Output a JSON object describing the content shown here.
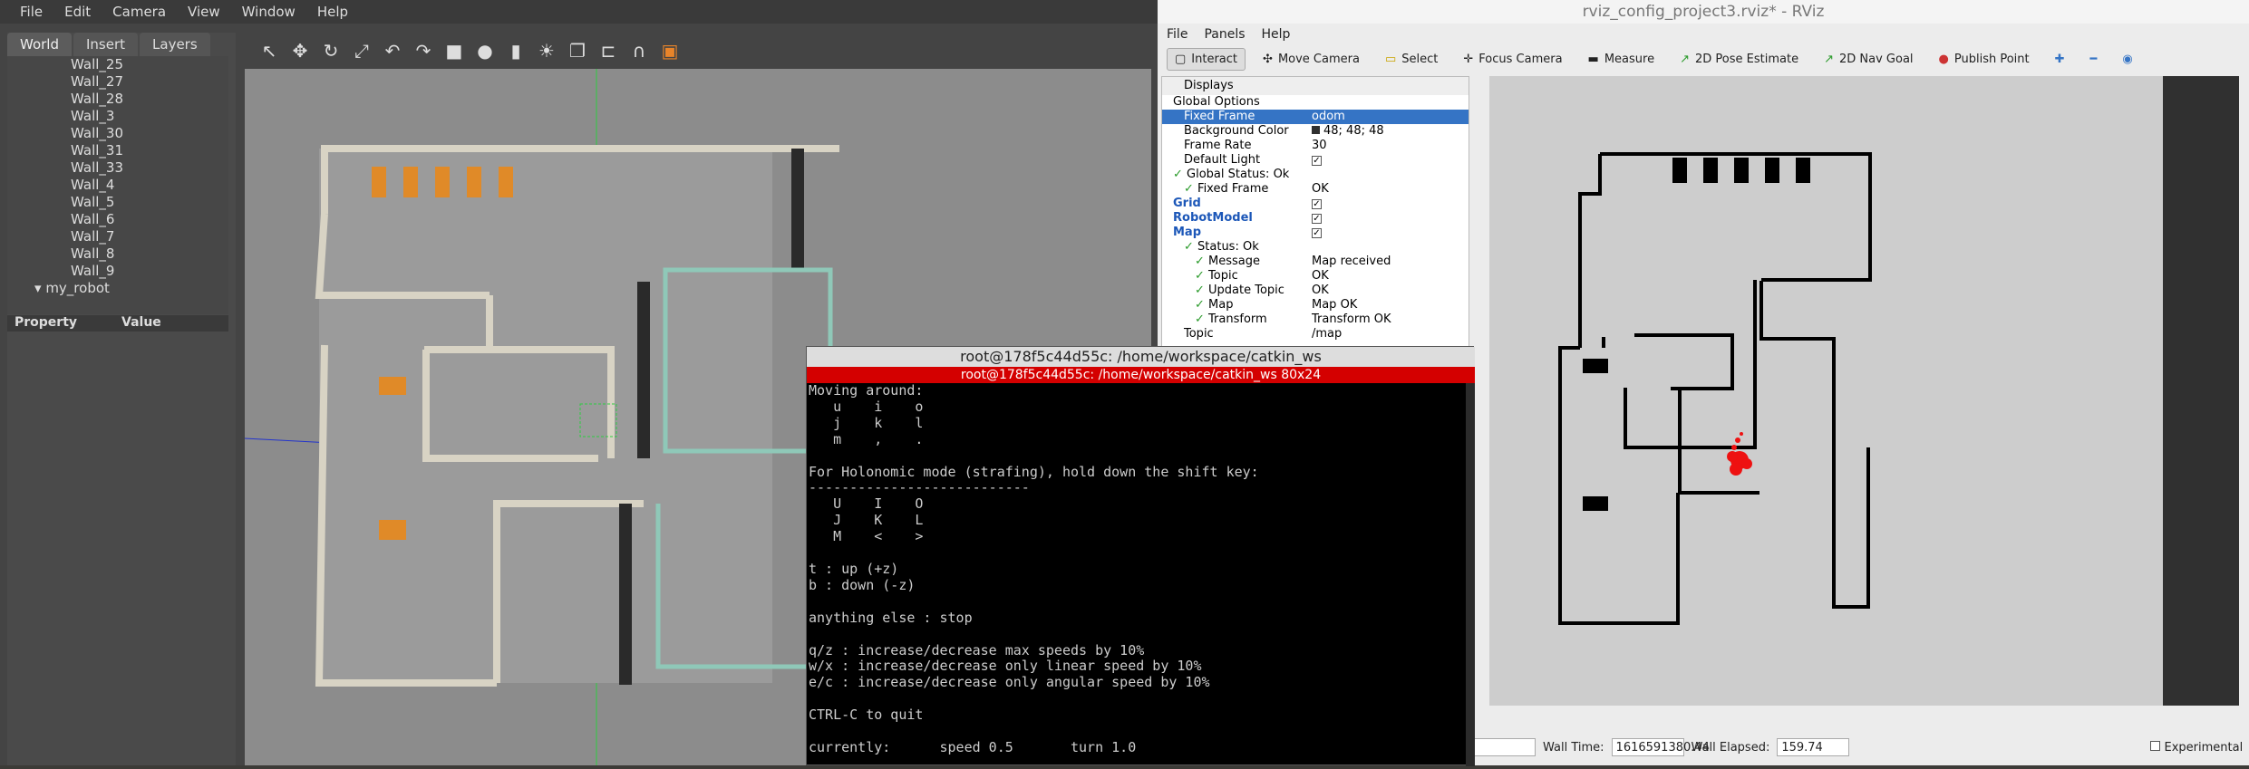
{
  "gazebo": {
    "menu": [
      "File",
      "Edit",
      "Camera",
      "View",
      "Window",
      "Help"
    ],
    "tabs": [
      "World",
      "Insert",
      "Layers"
    ],
    "tree": [
      "Wall_25",
      "Wall_27",
      "Wall_28",
      "Wall_3",
      "Wall_30",
      "Wall_31",
      "Wall_33",
      "Wall_4",
      "Wall_5",
      "Wall_6",
      "Wall_7",
      "Wall_8",
      "Wall_9"
    ],
    "robot": "my_robot",
    "prop_header": "Property",
    "value_header": "Value"
  },
  "rviz": {
    "title": "rviz_config_project3.rviz* - RViz",
    "menu": [
      "File",
      "Panels",
      "Help"
    ],
    "tools": [
      "Interact",
      "Move Camera",
      "Select",
      "Focus Camera",
      "Measure",
      "2D Pose Estimate",
      "2D Nav Goal",
      "Publish Point"
    ],
    "displays_label": "Displays",
    "rows": [
      {
        "k": "Global Options",
        "v": "",
        "indent": 1
      },
      {
        "k": "Fixed Frame",
        "v": "odom",
        "indent": 2,
        "sel": true
      },
      {
        "k": "Background Color",
        "v": "48; 48; 48",
        "indent": 2,
        "swatch": true
      },
      {
        "k": "Frame Rate",
        "v": "30",
        "indent": 2
      },
      {
        "k": "Default Light",
        "v": "✓",
        "indent": 2,
        "box": true
      },
      {
        "k": "Global Status: Ok",
        "v": "",
        "indent": 1,
        "okchk": true
      },
      {
        "k": "Fixed Frame",
        "v": "OK",
        "indent": 2,
        "okchk": true
      },
      {
        "k": "Grid",
        "v": "✓",
        "indent": 1,
        "blue": true,
        "box": true
      },
      {
        "k": "RobotModel",
        "v": "✓",
        "indent": 1,
        "blue": true,
        "box": true
      },
      {
        "k": "Map",
        "v": "✓",
        "indent": 1,
        "blue": true,
        "box": true
      },
      {
        "k": "Status: Ok",
        "v": "",
        "indent": 2,
        "okchk": true
      },
      {
        "k": "Message",
        "v": "Map received",
        "indent": 3,
        "okchk": true
      },
      {
        "k": "Topic",
        "v": "OK",
        "indent": 3,
        "okchk": true
      },
      {
        "k": "Update Topic",
        "v": "OK",
        "indent": 3,
        "okchk": true
      },
      {
        "k": "Map",
        "v": "Map OK",
        "indent": 3,
        "okchk": true
      },
      {
        "k": "Transform",
        "v": "Transform OK",
        "indent": 3,
        "okchk": true
      },
      {
        "k": "Topic",
        "v": "/map",
        "indent": 2
      }
    ],
    "wall_time_label": "Wall Time:",
    "wall_time": "1616591380.44",
    "wall_elapsed_label": "Wall Elapsed:",
    "wall_elapsed": "159.74",
    "experimental": "Experimental"
  },
  "terminal": {
    "title": "root@178f5c44d55c: /home/workspace/catkin_ws",
    "bar": "root@178f5c44d55c: /home/workspace/catkin_ws 80x24",
    "lines": [
      "Moving around:",
      "   u    i    o",
      "   j    k    l",
      "   m    ,    .",
      "",
      "For Holonomic mode (strafing), hold down the shift key:",
      "---------------------------",
      "   U    I    O",
      "   J    K    L",
      "   M    <    >",
      "",
      "t : up (+z)",
      "b : down (-z)",
      "",
      "anything else : stop",
      "",
      "q/z : increase/decrease max speeds by 10%",
      "w/x : increase/decrease only linear speed by 10%",
      "e/c : increase/decrease only angular speed by 10%",
      "",
      "CTRL-C to quit",
      "",
      "currently:      speed 0.5       turn 1.0"
    ]
  }
}
